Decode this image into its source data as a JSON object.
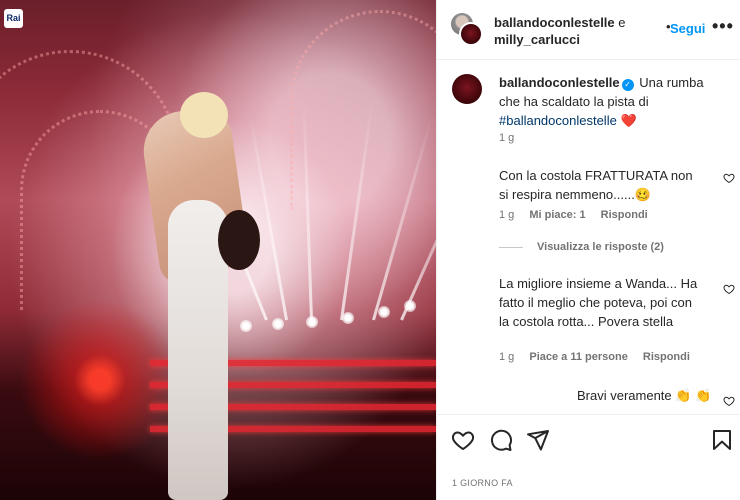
{
  "photo": {
    "badge": "Rai"
  },
  "header": {
    "account_1": "ballandoconlestelle",
    "conjunction": "e",
    "account_2": "milly_carlucci",
    "dot": "•",
    "follow_label": "Segui",
    "more_label": "•••"
  },
  "caption": {
    "username": "ballandoconlestelle",
    "text": "Una rumba che ha scaldato la pista di",
    "hashtag": "#ballandoconlestelle",
    "emoji": "❤️",
    "time": "1 g"
  },
  "comments": [
    {
      "text": "Con la costola FRATTURATA non si respira nemmeno......🥴",
      "time": "1 g",
      "likes": "Mi piace: 1",
      "reply": "Rispondi"
    },
    {
      "text": "La migliore insieme a Wanda... Ha fatto il meglio che poteva, poi con la costola rotta... Povera stella",
      "time": "1 g",
      "likes": "Piace a 11 persone",
      "reply": "Rispondi"
    },
    {
      "text": "Bravi veramente 👏 👏"
    }
  ],
  "view_replies": "Visualizza le risposte (2)",
  "timestamp": "1 GIORNO FA",
  "icons": {
    "like": "heart-icon",
    "comment": "comment-icon",
    "share": "send-icon",
    "save": "bookmark-icon"
  },
  "colors": {
    "link": "#0095f6",
    "hashtag": "#00376b",
    "meta": "#737373",
    "text": "#262626"
  }
}
